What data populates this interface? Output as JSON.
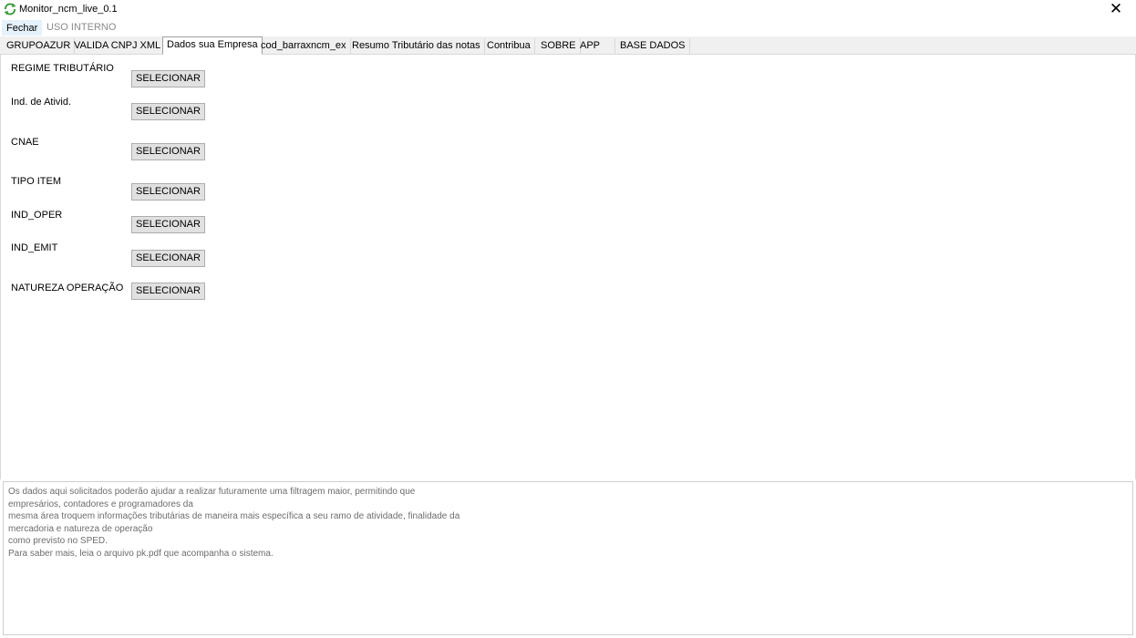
{
  "window": {
    "title": "Monitor_ncm_live_0.1",
    "close_glyph": "✕",
    "app_icon": "refresh-arrows-icon",
    "accent_color": "#3a9a3a"
  },
  "menu": {
    "items": [
      {
        "label": "Fechar"
      },
      {
        "label": "USO INTERNO"
      }
    ]
  },
  "tabs": [
    {
      "label": "GRUPOAZUR"
    },
    {
      "label": "VALIDA CNPJ XML"
    },
    {
      "label": "Dados sua Empresa",
      "active": true
    },
    {
      "label": "cod_barraxncm_ex"
    },
    {
      "label": "Resumo Tributário das notas"
    },
    {
      "label": "Contribua"
    },
    {
      "label": "SOBRE"
    },
    {
      "label": "APP"
    },
    {
      "label": "BASE DADOS"
    }
  ],
  "form": {
    "rows": [
      {
        "label": "REGIME TRIBUTÁRIO",
        "button": "SELECIONAR"
      },
      {
        "label": "Ind. de Ativid.",
        "button": "SELECIONAR"
      },
      {
        "label": "CNAE",
        "button": "SELECIONAR"
      },
      {
        "label": "TIPO ITEM",
        "button": "SELECIONAR"
      },
      {
        "label": "IND_OPER",
        "button": "SELECIONAR"
      },
      {
        "label": "IND_EMIT",
        "button": "SELECIONAR"
      },
      {
        "label": "NATUREZA OPERAÇÃO",
        "button": "SELECIONAR"
      }
    ]
  },
  "info": {
    "lines": [
      "Os dados aqui solicitados poderão ajudar a realizar futuramente uma filtragem maior, permitindo que",
      "empresários, contadores e programadores da",
      "mesma área troquem informações tributárias de maneira mais específica a seu ramo de atividade, finalidade da",
      "mercadoria e natureza de operação",
      "como previsto no SPED.",
      "Para saber mais, leia o arquivo pk.pdf que acompanha o sistema."
    ]
  }
}
